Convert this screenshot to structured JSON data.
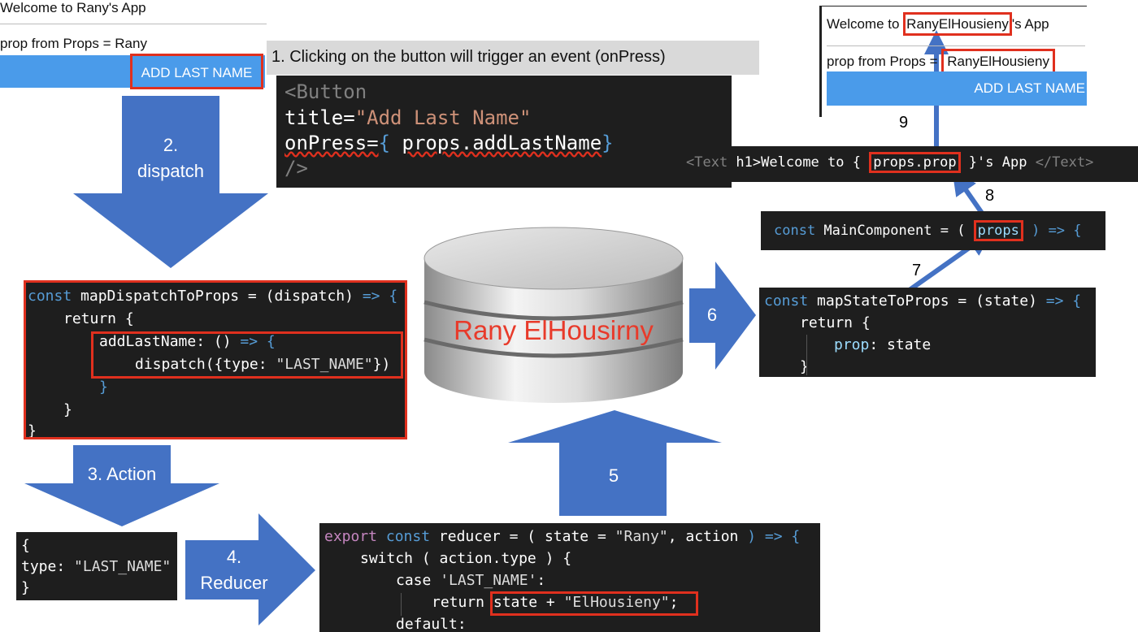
{
  "app_top_left": {
    "welcome": "Welcome to Rany's App",
    "prop_line": "prop from Props = Rany",
    "button": "ADD LAST NAME"
  },
  "app_top_right": {
    "welcome_prefix": "Welcome to ",
    "welcome_name": "RanyElHousieny",
    "welcome_suffix": "'s App",
    "prop_prefix": "prop from Props = ",
    "prop_value": "RanyElHousieny",
    "button": "ADD LAST NAME"
  },
  "step1_caption": "1. Clicking on the button will trigger an event (onPress)",
  "button_code": {
    "l1": "<Button",
    "l2_attr": "title=",
    "l2_val": "\"Add Last Name\"",
    "l3_attr": "onPress=",
    "l3_open": "{ ",
    "l3_expr": "props.addLastName",
    "l3_close": "}",
    "l4": "/>"
  },
  "text_code": {
    "open": "<Text",
    "attr": " h1>",
    "text1": "Welcome to { ",
    "expr": "props.prop",
    "text2": " }'s App ",
    "close": "</Text>"
  },
  "main_component_code": {
    "kw": "const",
    "name": " MainComponent",
    "eq": " = ( ",
    "param": "props",
    "arrow": " ) => {"
  },
  "map_state_code": {
    "l1_kw": "const",
    "l1_name": " mapStateToProps",
    "l1_rest": " = (state) ",
    "l1_arrow": "=> {",
    "l2_kw": "return",
    "l2_rest": " {",
    "l3_key": "prop",
    "l3_val": ": state",
    "l4": "}"
  },
  "map_dispatch_code": {
    "l1_kw": "const",
    "l1_name": " mapDispatchToProps",
    "l1_rest": " = (dispatch) ",
    "l1_arrow": "=> {",
    "l2_kw": "return",
    "l2_rest": " {",
    "l3_name": "addLastName",
    "l3_rest": ": () ",
    "l3_arrow": "=> {",
    "l4_fn": "dispatch",
    "l4_open": "({",
    "l4_key": "type",
    "l4_colon": ": ",
    "l4_val": "\"LAST_NAME\"",
    "l4_close": "})",
    "l5": "}",
    "l6": "}",
    "l7": "}"
  },
  "action_code": {
    "l1": "{",
    "l2_key": "type",
    "l2_colon": ": ",
    "l2_val": "\"LAST_NAME\"",
    "l3": "}"
  },
  "reducer_code": {
    "l1_export": "export",
    "l1_kw": " const",
    "l1_name": " reducer",
    "l1_eq": " = ( ",
    "l1_state": "state",
    "l1_eq2": " = ",
    "l1_def": "\"Rany\"",
    "l1_comma": ", ",
    "l1_action": "action",
    "l1_arrow": " ) => {",
    "l2_kw": "switch",
    "l2_open": " ( ",
    "l2_expr": "action.type",
    "l2_close": " ) {",
    "l3_kw": "case",
    "l3_val": " 'LAST_NAME'",
    "l3_colon": ":",
    "l4_kw": "return",
    "l4_state": " state",
    "l4_plus": " + ",
    "l4_str": "\"ElHousieny\"",
    "l4_semi": ";",
    "l5": "default:"
  },
  "store_label": "Rany ElHousirny",
  "arrows": {
    "a2_num": "2.",
    "a2_text": "dispatch",
    "a3": "3. Action",
    "a4_num": "4.",
    "a4_text": "Reducer",
    "a5": "5",
    "a6": "6",
    "a7": "7",
    "a8": "8",
    "a9": "9"
  },
  "colors": {
    "arrow_blue": "#4472c4",
    "highlight_red": "#e0301e",
    "button_blue": "#4a9bea",
    "code_bg": "#1e1e1e",
    "store_text": "#e83a2a"
  }
}
